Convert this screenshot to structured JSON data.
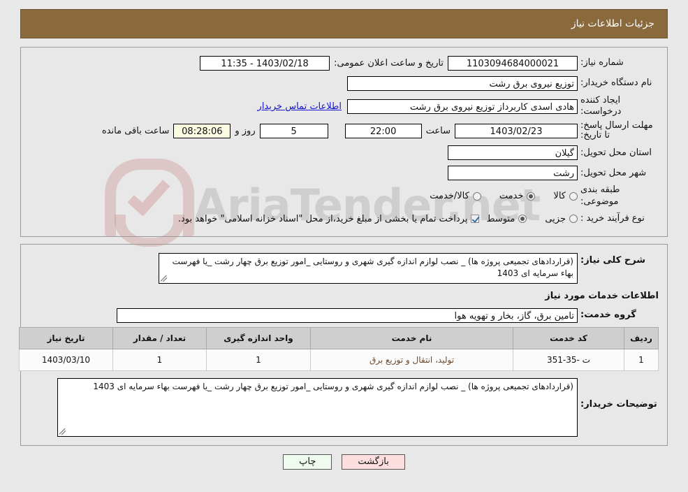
{
  "header": {
    "title": "جزئیات اطلاعات نیاز"
  },
  "form": {
    "need_number_label": "شماره نیاز:",
    "need_number_value": "1103094684000021",
    "public_announcement_label": "تاریخ و ساعت اعلان عمومی:",
    "public_announcement_value": "1403/02/18 - 11:35",
    "buyer_org_label": "نام دستگاه خریدار:",
    "buyer_org_value": "توزیع نیروی برق رشت",
    "request_creator_label": "ایجاد کننده درخواست:",
    "request_creator_value": "هادی  اسدی کاربرداز توزیع نیروی برق رشت",
    "buyer_contact_link": "اطلاعات تماس خریدار",
    "deadline_label": "مهلت ارسال پاسخ: تا تاریخ:",
    "deadline_value": "1403/02/23",
    "hour_label": "ساعت",
    "hour_value": "22:00",
    "days_value": "5",
    "days_label": "روز و",
    "remaining_value": "08:28:06",
    "remaining_label": "ساعت باقی مانده",
    "province_label": "استان محل تحویل:",
    "province_value": "گیلان",
    "city_label": "شهر محل تحویل:",
    "city_value": "رشت",
    "category_label": "طبقه بندی موضوعی:",
    "category_options": [
      {
        "label": "کالا",
        "selected": false
      },
      {
        "label": "خدمت",
        "selected": true
      },
      {
        "label": "کالا/خدمت",
        "selected": false
      }
    ],
    "purchase_type_label": "نوع فرآیند خرید :",
    "purchase_type_options": [
      {
        "label": "جزیی",
        "selected": false
      },
      {
        "label": "متوسط",
        "selected": true
      }
    ],
    "treasury_checkbox_checked": true,
    "treasury_note": "پرداخت تمام یا بخشی از مبلغ خرید،از محل \"اسناد خزانه اسلامی\" خواهد بود."
  },
  "description": {
    "label": "شرح کلی نیاز:",
    "value": "(قراردادهای تجمیعی پروژه ها) _ نصب لوازم اندازه گیری شهری و روستایی _امور توزیع برق چهار رشت _یا فهرست بهاء سرمایه ای 1403"
  },
  "services_section": {
    "title": "اطلاعات خدمات مورد نیاز",
    "service_group_label": "گروه خدمت:",
    "service_group_value": "تامین برق، گاز، بخار و تهویه هوا"
  },
  "table": {
    "columns": [
      "ردیف",
      "کد خدمت",
      "نام خدمت",
      "واحد اندازه گیری",
      "تعداد / مقدار",
      "تاریخ نیاز"
    ],
    "rows": [
      {
        "index": "1",
        "code": "ت -35-351",
        "name": "تولید، انتقال و توزیع برق",
        "unit": "1",
        "quantity": "1",
        "need_date": "1403/03/10"
      }
    ]
  },
  "buyer_notes": {
    "label": "توضیحات خریدار:",
    "value": "(قراردادهای تجمیعی پروژه ها) _ نصب لوازم اندازه گیری شهری و روستایی _امور توزیع برق چهار رشت _یا فهرست بهاء سرمایه ای 1403"
  },
  "footer": {
    "print_label": "چاپ",
    "back_label": "بازگشت"
  },
  "watermark": {
    "text": "AriaTender.net"
  },
  "colors": {
    "header_bg": "#8a6a3d",
    "page_bg": "#e8e8e8",
    "link": "#1414d2",
    "timer_bg": "#fbfbe2",
    "print_btn": "#eefbee",
    "back_btn": "#fcdede",
    "table_header_bg": "#cfcfcf"
  }
}
